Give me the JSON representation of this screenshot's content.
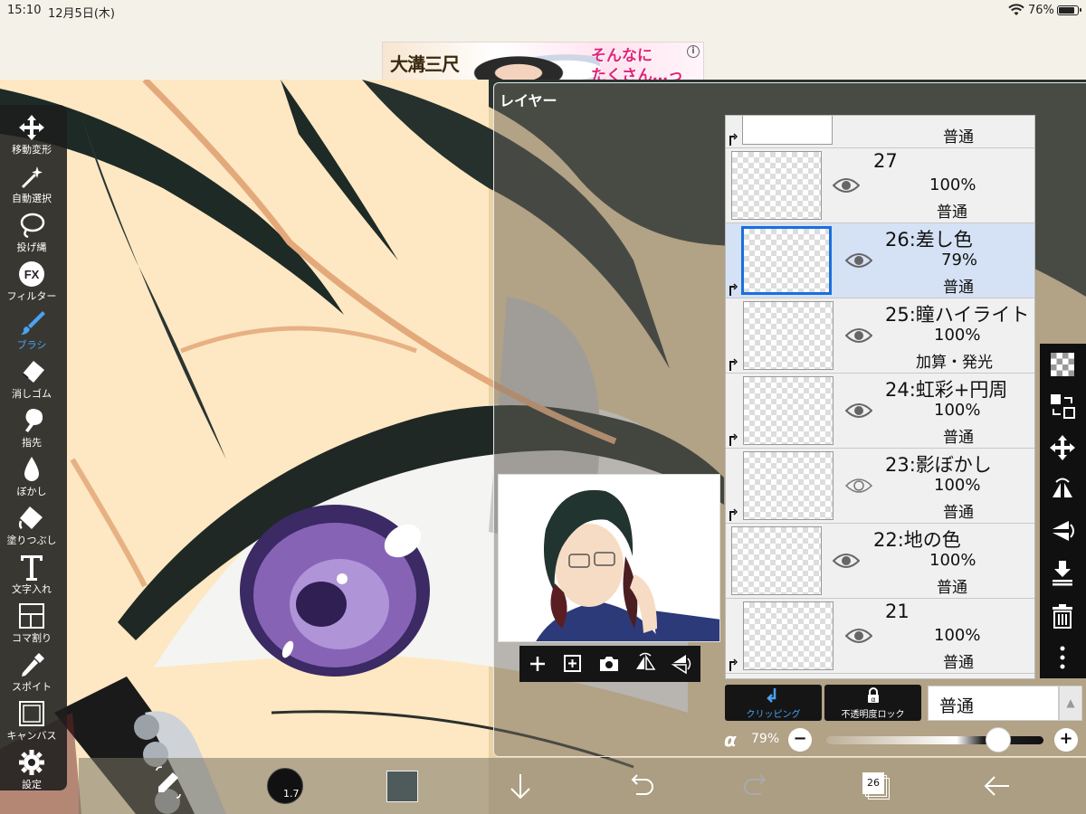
{
  "status_bar": {
    "time": "15:10",
    "date": "12月5日(木)",
    "battery": "76%"
  },
  "ad": {
    "logo_text": "大溝三尺",
    "catch_line1": "そんなに",
    "catch_line2": "たくさん…っ",
    "info": "i"
  },
  "toolbar": [
    {
      "name": "move",
      "label": "移動変形",
      "icon": "move-arrows-icon"
    },
    {
      "name": "magic-wand",
      "label": "自動選択",
      "icon": "magic-wand-icon"
    },
    {
      "name": "lasso",
      "label": "投げ縄",
      "icon": "lasso-icon"
    },
    {
      "name": "filter",
      "label": "フィルター",
      "icon": "fx-icon"
    },
    {
      "name": "brush",
      "label": "ブラシ",
      "icon": "brush-icon",
      "active": true
    },
    {
      "name": "eraser",
      "label": "消しゴム",
      "icon": "eraser-icon"
    },
    {
      "name": "smudge",
      "label": "指先",
      "icon": "smudge-icon"
    },
    {
      "name": "blur",
      "label": "ぼかし",
      "icon": "blur-drop-icon"
    },
    {
      "name": "fill",
      "label": "塗りつぶし",
      "icon": "fill-bucket-icon"
    },
    {
      "name": "text",
      "label": "文字入れ",
      "icon": "text-icon"
    },
    {
      "name": "frame",
      "label": "コマ割り",
      "icon": "frame-divider-icon"
    },
    {
      "name": "eyedropper",
      "label": "スポイト",
      "icon": "eyedropper-icon"
    },
    {
      "name": "canvas",
      "label": "キャンバス",
      "icon": "canvas-icon"
    },
    {
      "name": "settings",
      "label": "設定",
      "icon": "gear-icon"
    }
  ],
  "layer_panel": {
    "title": "レイヤー",
    "top_partial_blend": "普通",
    "layers": [
      {
        "name": "27",
        "opacity": "100%",
        "blend": "普通",
        "clipped": false,
        "selected": false,
        "eye": "visible"
      },
      {
        "name": "26:差し色",
        "opacity": "79%",
        "blend": "普通",
        "clipped": true,
        "selected": true,
        "eye": "visible"
      },
      {
        "name": "25:瞳ハイライト",
        "opacity": "100%",
        "blend": "加算・発光",
        "clipped": true,
        "selected": false,
        "eye": "visible"
      },
      {
        "name": "24:虹彩+円周",
        "opacity": "100%",
        "blend": "普通",
        "clipped": true,
        "selected": false,
        "eye": "visible"
      },
      {
        "name": "23:影ぼかし",
        "opacity": "100%",
        "blend": "普通",
        "clipped": true,
        "selected": false,
        "eye": "hidden"
      },
      {
        "name": "22:地の色",
        "opacity": "100%",
        "blend": "普通",
        "clipped": false,
        "selected": false,
        "eye": "visible"
      },
      {
        "name": "21",
        "opacity": "100%",
        "blend": "普通",
        "clipped": true,
        "selected": false,
        "eye": "visible"
      }
    ],
    "clipping_label": "クリッピング",
    "opacity_lock_label": "不透明度ロック",
    "blend_mode_value": "普通",
    "alpha_symbol": "α",
    "alpha_value": "79%",
    "alpha_level": 0.79,
    "minus": "−",
    "plus": "+"
  },
  "right_strip_icons": [
    "new-transparent-layer-icon",
    "swap-layer-icon",
    "move-layer-icon",
    "flip-horizontal-icon",
    "flip-vertical-icon",
    "merge-down-icon",
    "trash-icon",
    "more-vertical-icon"
  ],
  "preview_toolbar_icons": [
    "add-layer-icon",
    "add-layer-copy-icon",
    "camera-icon",
    "flip-h-icon",
    "flip-v-icon"
  ],
  "bottom_bar": {
    "brush_size": "1.7",
    "layer_count": "26",
    "color": "#4f5a5a"
  },
  "colors": {
    "accent": "#4aa2f2",
    "selected_row": "#d5e2f5",
    "selected_border": "#1a6ee0"
  }
}
